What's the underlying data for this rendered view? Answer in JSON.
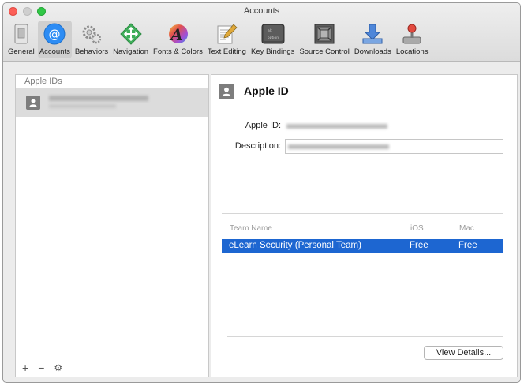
{
  "window": {
    "title": "Accounts"
  },
  "toolbar": {
    "items": [
      {
        "label": "General",
        "icon": "general-icon"
      },
      {
        "label": "Accounts",
        "icon": "accounts-at-icon",
        "active": true
      },
      {
        "label": "Behaviors",
        "icon": "gears-icon"
      },
      {
        "label": "Navigation",
        "icon": "navigation-arrows-icon"
      },
      {
        "label": "Fonts & Colors",
        "icon": "font-a-icon"
      },
      {
        "label": "Text Editing",
        "icon": "text-editing-icon"
      },
      {
        "label": "Key Bindings",
        "icon": "keyboard-key-icon"
      },
      {
        "label": "Source Control",
        "icon": "source-control-icon"
      },
      {
        "label": "Downloads",
        "icon": "downloads-icon"
      },
      {
        "label": "Locations",
        "icon": "locations-joystick-icon"
      }
    ]
  },
  "sidebar": {
    "header": "Apple IDs",
    "footer": {
      "add": "+",
      "remove": "−",
      "gear": "⚙"
    }
  },
  "detail": {
    "title": "Apple ID",
    "apple_id_label": "Apple ID:",
    "description_label": "Description:",
    "teams": {
      "columns": [
        "Team Name",
        "iOS",
        "Mac"
      ],
      "rows": [
        {
          "name": "eLearn Security (Personal Team)",
          "ios": "Free",
          "mac": "Free",
          "selected": true
        }
      ]
    },
    "view_details": "View Details..."
  },
  "colors": {
    "selection": "#1d66d1",
    "accent": "#2c8cf4"
  }
}
